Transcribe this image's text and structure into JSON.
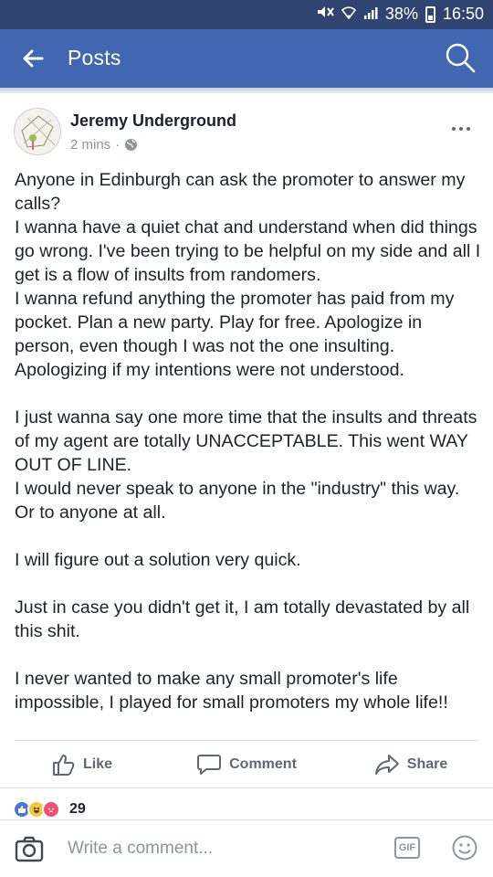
{
  "status_bar": {
    "battery": "38%",
    "time": "16:50"
  },
  "app_bar": {
    "title": "Posts"
  },
  "post": {
    "author": "Jeremy Underground",
    "time": "2 mins",
    "separator": "·",
    "paragraphs": [
      "Anyone in Edinburgh can ask the promoter to answer my calls?\nI wanna have a quiet chat and understand when did things go wrong. I've been trying to be helpful on my side and all I get is  a flow of insults from randomers.\nI wanna refund anything the promoter has paid from my pocket. Plan a new party. Play for free. Apologize in person, even though I was not the one insulting. Apologizing if my intentions were not understood.",
      "I just wanna say one more time that the insults and threats of my agent are totally UNACCEPTABLE. This went WAY OUT OF LINE.\nI would never speak to anyone in the \"industry\" this way. Or to anyone at all.",
      "I will figure out a solution very quick.",
      "Just in case you didn't get it, I am totally devastated by all this shit.",
      "I never wanted to make any small promoter's life impossible, I played for small promoters my whole life!!"
    ]
  },
  "actions": {
    "like": "Like",
    "comment": "Comment",
    "share": "Share"
  },
  "reactions": {
    "count": "29"
  },
  "comment_bar": {
    "placeholder": "Write a comment...",
    "gif": "GIF"
  },
  "colors": {
    "status_bar": "#2f4470",
    "app_bar": "#4267b2",
    "text": "#1d2129",
    "muted": "#606770"
  }
}
